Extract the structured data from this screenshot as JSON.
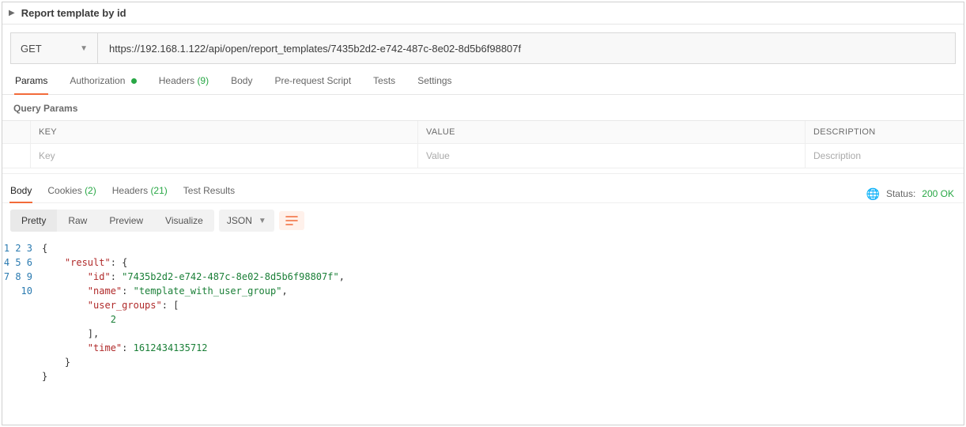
{
  "title": "Report template by id",
  "method": "GET",
  "url": "https://192.168.1.122/api/open/report_templates/7435b2d2-e742-487c-8e02-8d5b6f98807f",
  "req_tabs": {
    "params": "Params",
    "authorization": "Authorization",
    "headers": "Headers",
    "headers_count": "(9)",
    "body": "Body",
    "prerequest": "Pre-request Script",
    "tests": "Tests",
    "settings": "Settings"
  },
  "query_params": {
    "title": "Query Params",
    "headers": {
      "key": "KEY",
      "value": "VALUE",
      "description": "DESCRIPTION"
    },
    "placeholders": {
      "key": "Key",
      "value": "Value",
      "description": "Description"
    }
  },
  "resp_tabs": {
    "body": "Body",
    "cookies": "Cookies",
    "cookies_count": "(2)",
    "headers": "Headers",
    "headers_count": "(21)",
    "test_results": "Test Results"
  },
  "status": {
    "label": "Status:",
    "value": "200 OK"
  },
  "view": {
    "pretty": "Pretty",
    "raw": "Raw",
    "preview": "Preview",
    "visualize": "Visualize",
    "format": "JSON"
  },
  "response_body": {
    "lines": [
      "1",
      "2",
      "3",
      "4",
      "5",
      "6",
      "7",
      "8",
      "9",
      "10"
    ],
    "result_key": "\"result\"",
    "id_key": "\"id\"",
    "id_val": "\"7435b2d2-e742-487c-8e02-8d5b6f98807f\"",
    "name_key": "\"name\"",
    "name_val": "\"template_with_user_group\"",
    "ug_key": "\"user_groups\"",
    "ug_val": "2",
    "time_key": "\"time\"",
    "time_val": "1612434135712"
  }
}
